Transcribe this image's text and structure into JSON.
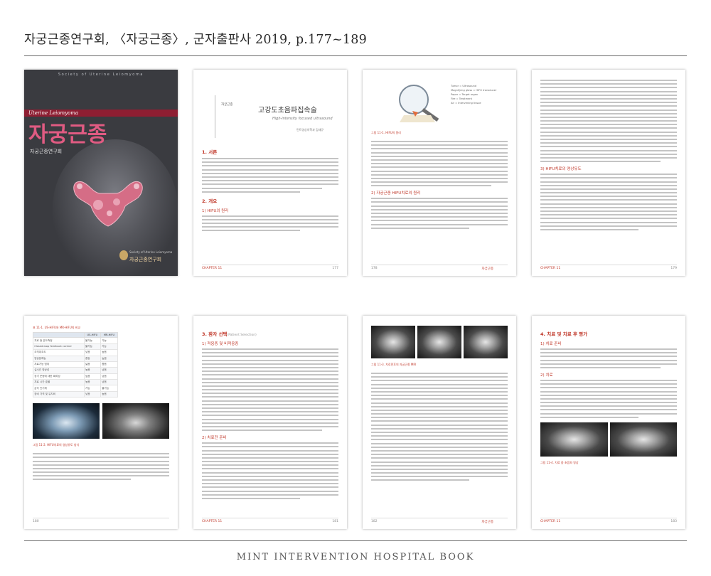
{
  "header": {
    "title": "자궁근종연구회, 〈자궁근종〉, 군자출판사 2019, p.177~189"
  },
  "footer": {
    "brand": "MINT INTERVENTION HOSPITAL BOOK"
  },
  "cover": {
    "series": "Society of Uterine Leiomyoma",
    "band": "Uterine Leiomyoma",
    "title": "자궁근종",
    "subtitle": "자궁근종연구회",
    "publisher_small": "Society of Uterine Leiomyoma",
    "publisher": "자궁근종연구회"
  },
  "pages": {
    "p177": {
      "tag": "자궁근종",
      "chapter_title": "고강도초음파집속술",
      "chapter_en": "High-intensity focused ultrasound",
      "author": "민트영상의학과  김재규",
      "section1": "1. 서론",
      "section2": "2. 개요",
      "sub1": "1) HIFU의 원리",
      "foot_chapter": "CHAPTER 11",
      "page_num": "177"
    },
    "p178": {
      "caption": "그림 11-1. HIFU의 원리",
      "legend": [
        "Tumor = Ultrasound",
        "Magnifying glass = HIFU transducer",
        "Paper = Target organ",
        "Fire = Treatment",
        "Air = Intervening tissue"
      ],
      "sub2": "2) 자궁근종 HIFU치료의 원리",
      "page_num": "178",
      "foot_chapter": "자궁근종"
    },
    "p179": {
      "sub3": "3) HIFU치료의 영상유도",
      "foot_chapter": "CHAPTER 11",
      "page_num": "179"
    },
    "p180": {
      "table_caption": "표 11-1. US-HIFU와 MR-HIFU의 비교",
      "table_headers": [
        "",
        "US-HIFU",
        "MR-HIFU"
      ],
      "table_rows": [
        [
          "치료 중 온도측정",
          "불가능",
          "가능"
        ],
        [
          "Closed-loop feedback control",
          "불가능",
          "가능"
        ],
        [
          "조직대조도",
          "낮음",
          "높음"
        ],
        [
          "영상분해능",
          "중등",
          "높음"
        ],
        [
          "치료가능 범위",
          "넓음",
          "좁음"
        ],
        [
          "실시간 영상성",
          "높음",
          "낮음"
        ],
        [
          "장기 운동에 대한 회피성",
          "높음",
          "낮음"
        ],
        [
          "치료 시간 효율",
          "높음",
          "낮음"
        ],
        [
          "금속 인기체",
          "가능",
          "불가능"
        ],
        [
          "장비 가격 및 유지비",
          "낮음",
          "높음"
        ]
      ],
      "figure_caption": "그림 11-2. HIFU치료의 영상유도 방식",
      "page_num": "180"
    },
    "p181": {
      "section3": "3. 환자 선택",
      "section3_en": "(Patient Selection)",
      "sub1": "1) 적응증 및 비적응증",
      "sub2": "2) 치료전 준비",
      "foot_chapter": "CHAPTER 11",
      "page_num": "181"
    },
    "p182": {
      "figure_caption": "그림 11-3. 치료전후의 자궁근종 MRI",
      "page_num": "182",
      "foot_chapter": "자궁근종"
    },
    "p183": {
      "section4": "4. 치료 및 치료 후 평가",
      "sub1": "1) 치료 준비",
      "sub2": "2) 치료",
      "figure_caption": "그림 11-4. 치료 중 초음파 영상",
      "foot_chapter": "CHAPTER 11",
      "page_num": "183"
    }
  }
}
